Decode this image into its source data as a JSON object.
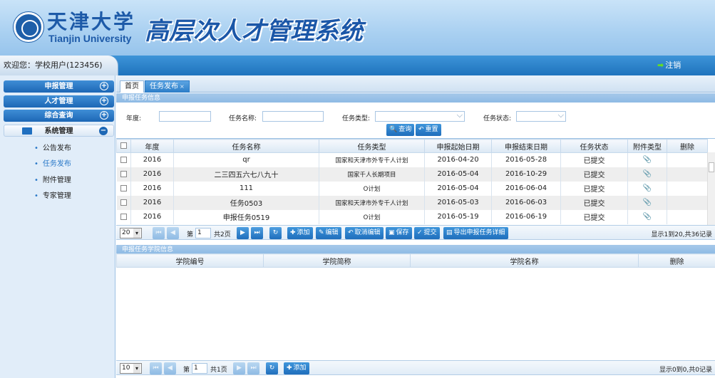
{
  "header": {
    "university_cn": "天津大学",
    "university_en": "Tianjin University",
    "system_title": "高层次人才管理系统"
  },
  "topbar": {
    "welcome": "欢迎您：学校用户(123456)",
    "logout": "注销"
  },
  "sidebar": {
    "menus": [
      {
        "label": "申报管理",
        "icon": "plus-circle-icon"
      },
      {
        "label": "人才管理",
        "icon": "plus-circle-icon"
      },
      {
        "label": "综合查询",
        "icon": "plus-circle-icon"
      },
      {
        "label": "系统管理",
        "icon": "minus-circle-icon"
      }
    ],
    "sub_items": [
      "公告发布",
      "任务发布",
      "附件管理",
      "专家管理"
    ],
    "active_sub": "任务发布"
  },
  "tabs": [
    {
      "label": "首页"
    },
    {
      "label": "任务发布",
      "close": "×"
    }
  ],
  "search_panel": {
    "title": "申报任务信息",
    "year_label": "年度:",
    "year_value": "",
    "name_label": "任务名称:",
    "name_value": "",
    "type_label": "任务类型:",
    "type_value": "",
    "status_label": "任务状态:",
    "status_value": "",
    "query_button": "查询",
    "reset_button": "重置"
  },
  "task_grid": {
    "columns": [
      "年度",
      "任务名称",
      "任务类型",
      "申报起始日期",
      "申报结束日期",
      "任务状态",
      "附件类型",
      "删除"
    ],
    "rows": [
      {
        "year": "2016",
        "name": "qr",
        "type": "国家和天津市外专千人计划",
        "start": "2016-04-20",
        "end": "2016-05-28",
        "status": "已提交"
      },
      {
        "year": "2016",
        "name": "二三四五六七八九十",
        "type": "国家千人长期项目",
        "start": "2016-05-04",
        "end": "2016-10-29",
        "status": "已提交"
      },
      {
        "year": "2016",
        "name": "111",
        "type": "O计划",
        "start": "2016-05-04",
        "end": "2016-06-04",
        "status": "已提交"
      },
      {
        "year": "2016",
        "name": "任务0503",
        "type": "国家和天津市外专千人计划",
        "start": "2016-05-03",
        "end": "2016-06-03",
        "status": "已提交"
      },
      {
        "year": "2016",
        "name": "申报任务0519",
        "type": "O计划",
        "start": "2016-05-19",
        "end": "2016-06-19",
        "status": "已提交"
      }
    ]
  },
  "task_pager": {
    "page_size": "20",
    "page_label": "第",
    "page_value": "1",
    "total_pages": "共2页",
    "add": "添加",
    "edit": "编辑",
    "cancel_edit": "取消编辑",
    "save": "保存",
    "submit": "提交",
    "export": "导出申报任务详细",
    "status": "显示1到20,共36记录"
  },
  "college_panel": {
    "title": "申报任务学院信息",
    "columns": [
      "学院编号",
      "学院简称",
      "学院名称",
      "删除"
    ]
  },
  "college_pager": {
    "page_size": "10",
    "page_label": "第",
    "page_value": "1",
    "total_pages": "共1页",
    "add": "添加",
    "status": "显示0到0,共0记录"
  },
  "colors": {
    "accent": "#1f6ebc",
    "header_bg": "#a9d0f1",
    "title": "#1b57a8"
  }
}
